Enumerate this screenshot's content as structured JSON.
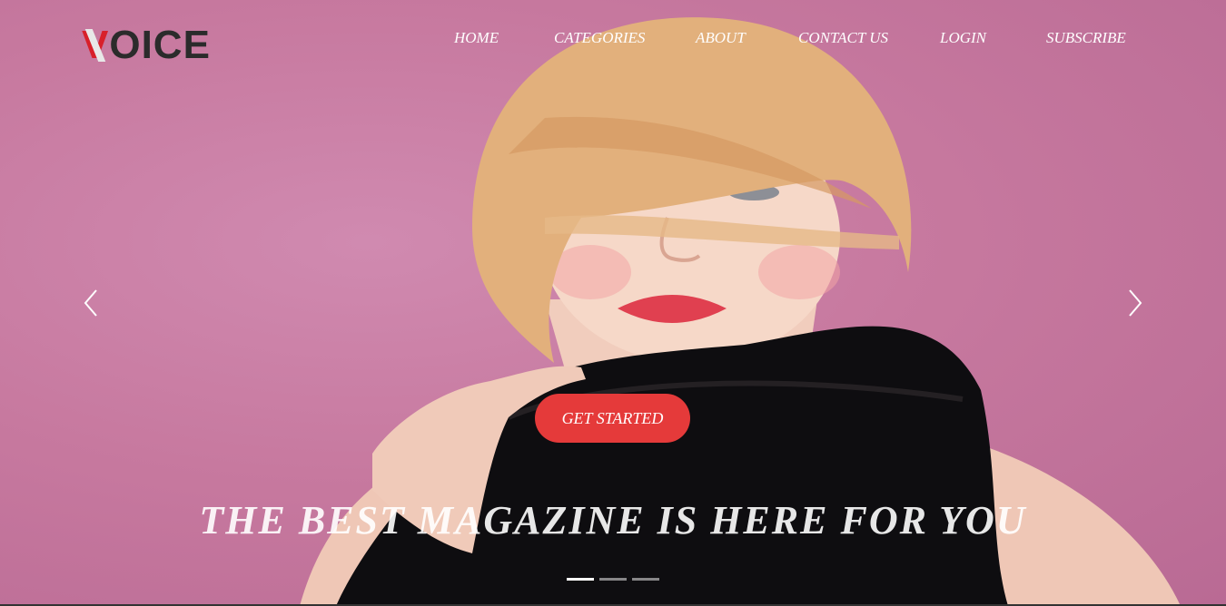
{
  "brand": {
    "logo_first": "V",
    "logo_rest": "OICE",
    "accent_color": "#d8202a"
  },
  "nav": {
    "items": [
      {
        "label": "HOME"
      },
      {
        "label": "CATEGORIES"
      },
      {
        "label": "ABOUT"
      },
      {
        "label": "CONTACT US"
      },
      {
        "label": "LOGIN"
      },
      {
        "label": "SUBSCRIBE"
      }
    ]
  },
  "hero": {
    "cta_label": "GET STARTED",
    "cta_color": "#e53a3a",
    "headline": "THE BEST MAGAZINE IS HERE FOR YOU",
    "background_color": "#c7799f",
    "prev_icon": "chevron-left-icon",
    "next_icon": "chevron-right-icon"
  },
  "carousel": {
    "slide_count": 3,
    "active_index": 0
  }
}
